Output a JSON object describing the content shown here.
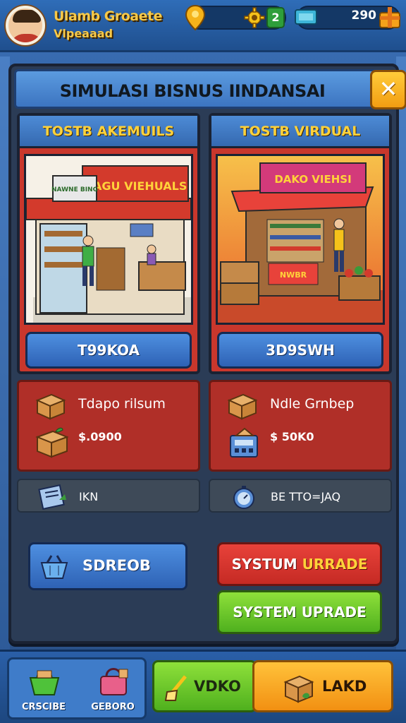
{
  "header": {
    "player_name": "Ulamb Groaete",
    "player_subtitle": "Vlpeaaad",
    "coins": "290",
    "green_badge": "2"
  },
  "panel": {
    "title": "SIMULASI BISNUS IINDANSAI",
    "close_label": "✕"
  },
  "stores": [
    {
      "heading": "TOSTB AKEMUILS",
      "sign_text": "NAGU VIEHUALS",
      "side_sign": "NAWNE BING",
      "button_label": "T99KOA",
      "info_label": "Tdapo rilsum",
      "info_value": "$.0900",
      "status_text": "IKN"
    },
    {
      "heading": "TOSTB VIRDUAL",
      "sign_text": "DAKO VIEHSI",
      "stall_sign": "NWBR",
      "button_label": "3D9SWH",
      "info_label": "Ndle Grnbep",
      "info_value": "$ 50K0",
      "status_text": "BE TTO=JAQ"
    }
  ],
  "actions": {
    "blue_label": "SDREOB",
    "red_label_a": "SYSTUM ",
    "red_label_b": "URRADE",
    "green_label": "SYSTEM UPRADE"
  },
  "bottom_nav": {
    "item1_label": "CRSCIBE",
    "item2_label": "GEBORO",
    "green_label": "VDKO",
    "orange_label": "LAKD"
  },
  "colors": {
    "accent_yellow": "#ffd23a",
    "panel_bg": "#2b3c56",
    "card_red": "#c9372c",
    "button_blue": "#2e62b5",
    "button_green": "#4fb01e",
    "button_orange": "#f29012"
  }
}
